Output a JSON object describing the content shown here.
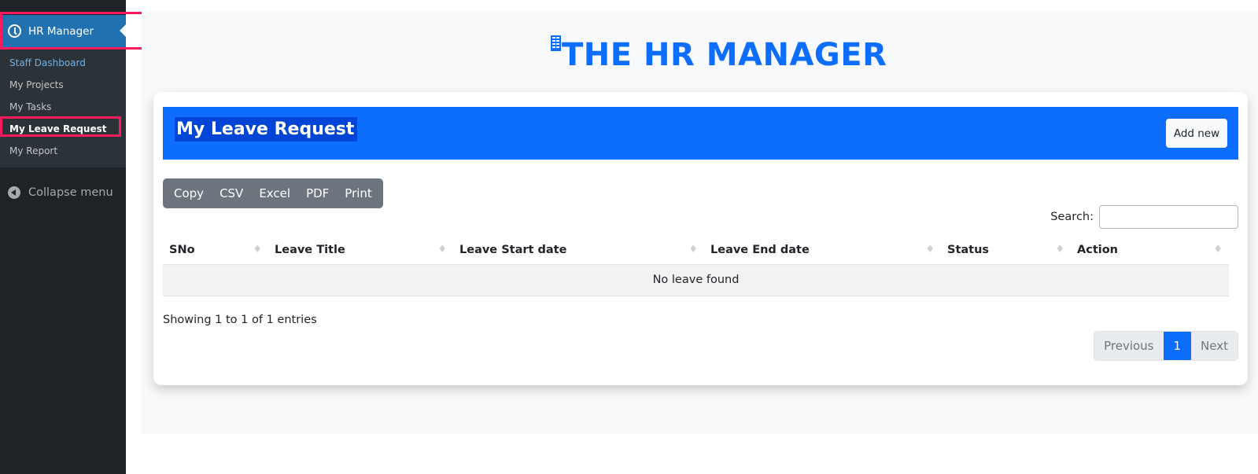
{
  "sidebar": {
    "menu_title": "HR Manager",
    "items": [
      {
        "label": "Staff Dashboard"
      },
      {
        "label": "My Projects"
      },
      {
        "label": "My Tasks"
      },
      {
        "label": "My Leave Request"
      },
      {
        "label": "My Report"
      }
    ],
    "collapse_label": "Collapse menu"
  },
  "header": {
    "brand_title": "THE HR MANAGER"
  },
  "card": {
    "title": "My Leave Request",
    "add_button": "Add new"
  },
  "export_buttons": [
    "Copy",
    "CSV",
    "Excel",
    "PDF",
    "Print"
  ],
  "search": {
    "label": "Search:",
    "value": "",
    "placeholder": ""
  },
  "table": {
    "columns": [
      "SNo",
      "Leave Title",
      "Leave Start date",
      "Leave End date",
      "Status",
      "Action"
    ],
    "empty_message": "No leave found"
  },
  "info": "Showing 1 to 1 of 1 entries",
  "pagination": {
    "previous": "Previous",
    "current": "1",
    "next": "Next"
  },
  "colors": {
    "primary": "#0d6efd",
    "sidebar_bg": "#1d2327",
    "menu_active_bg": "#2271b1",
    "highlight": "#ff1a5e"
  }
}
